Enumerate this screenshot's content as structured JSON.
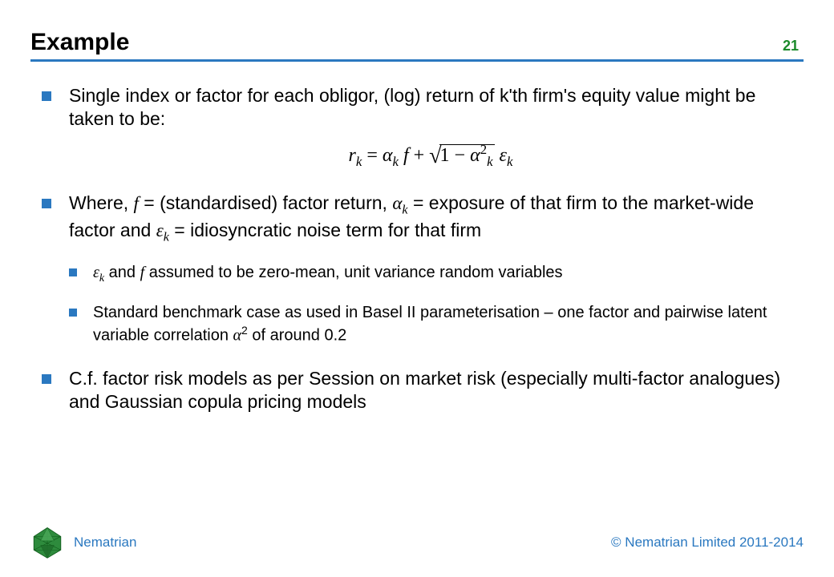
{
  "header": {
    "title": "Example",
    "page_number": "21"
  },
  "bullets": {
    "b1": "Single index or factor for each obligor, (log) return of k'th firm's equity value might be taken to be:",
    "b2_pre": "Where, ",
    "b2_f": "f",
    "b2_mid1": " = (standardised) factor return, ",
    "b2_alpha": "α",
    "b2_k": "k",
    "b2_mid2": " = exposure of that firm to the market-wide factor and ",
    "b2_eps": "ε",
    "b2_mid3": " = idiosyncratic noise term for that firm",
    "s1_eps": "ε",
    "s1_k": "k",
    "s1_mid1": " and ",
    "s1_f": "f",
    "s1_rest": " assumed to be zero-mean, unit variance random variables",
    "s2_pre": "Standard benchmark case as used in Basel II parameterisation – one factor and pairwise latent variable correlation ",
    "s2_alpha": "α",
    "s2_sup": "2",
    "s2_rest": " of around 0.2",
    "b3": "C.f. factor risk models as per Session on market risk (especially multi-factor analogues) and Gaussian copula pricing models"
  },
  "equation": {
    "r": "r",
    "k": "k",
    "eq": " = ",
    "alpha": "α",
    "f": " f ",
    "plus": " + ",
    "one_minus": "1 − ",
    "two": "2",
    "eps": " ε"
  },
  "footer": {
    "brand": "Nematrian",
    "copyright": "© Nematrian Limited 2011-2014"
  }
}
